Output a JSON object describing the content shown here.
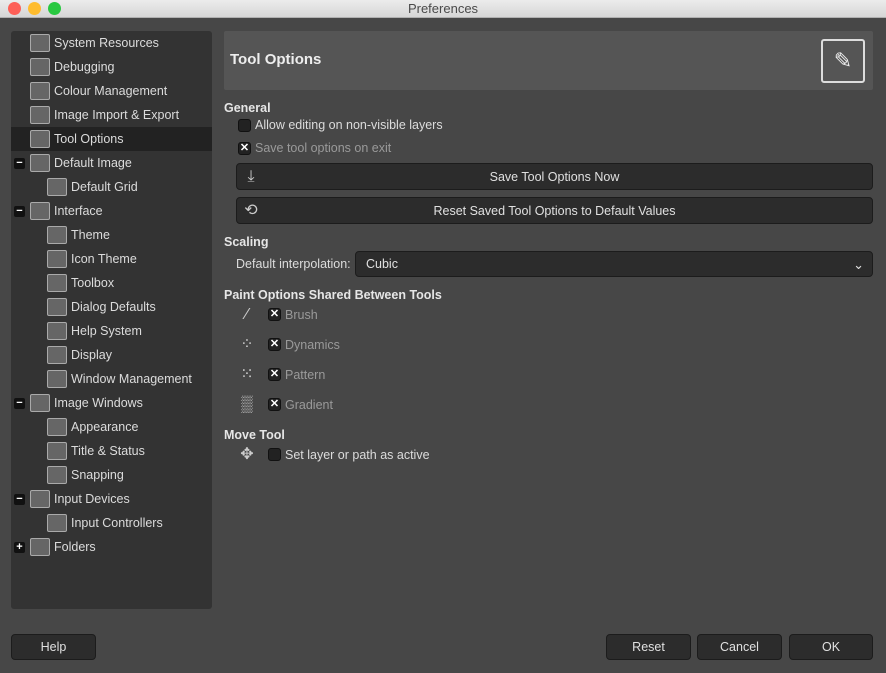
{
  "window": {
    "title": "Preferences"
  },
  "sidebar": {
    "items": [
      {
        "label": "System Resources",
        "icon": "chip-icon"
      },
      {
        "label": "Debugging",
        "icon": "wilber-icon"
      },
      {
        "label": "Colour Management",
        "icon": "color-circles-icon"
      },
      {
        "label": "Image Import & Export",
        "icon": "import-export-icon"
      },
      {
        "label": "Tool Options",
        "icon": "tool-options-icon"
      },
      {
        "label": "Default Image",
        "icon": "default-image-icon"
      },
      {
        "label": "Default Grid",
        "icon": "grid-icon"
      },
      {
        "label": "Interface",
        "icon": "interface-icon"
      },
      {
        "label": "Theme",
        "icon": "theme-icon"
      },
      {
        "label": "Icon Theme",
        "icon": "icon-theme-icon"
      },
      {
        "label": "Toolbox",
        "icon": "toolbox-icon"
      },
      {
        "label": "Dialog Defaults",
        "icon": "dialog-icon"
      },
      {
        "label": "Help System",
        "icon": "help-icon"
      },
      {
        "label": "Display",
        "icon": "display-icon"
      },
      {
        "label": "Window Management",
        "icon": "window-icon"
      },
      {
        "label": "Image Windows",
        "icon": "image-window-icon"
      },
      {
        "label": "Appearance",
        "icon": "appearance-icon"
      },
      {
        "label": "Title & Status",
        "icon": "title-status-icon"
      },
      {
        "label": "Snapping",
        "icon": "snapping-icon"
      },
      {
        "label": "Input Devices",
        "icon": "input-devices-icon"
      },
      {
        "label": "Input Controllers",
        "icon": "controller-icon"
      },
      {
        "label": "Folders",
        "icon": "folder-icon"
      }
    ]
  },
  "main": {
    "title": "Tool Options",
    "general": {
      "heading": "General",
      "allow_editing": "Allow editing on non-visible layers",
      "save_on_exit": "Save tool options on exit",
      "save_now": "Save Tool Options Now",
      "reset_saved": "Reset Saved Tool Options to Default Values"
    },
    "scaling": {
      "heading": "Scaling",
      "interp_label": "Default interpolation:",
      "interp_value": "Cubic"
    },
    "paint": {
      "heading": "Paint Options Shared Between Tools",
      "brush": "Brush",
      "dynamics": "Dynamics",
      "pattern": "Pattern",
      "gradient": "Gradient"
    },
    "move": {
      "heading": "Move Tool",
      "set_active": "Set layer or path as active"
    }
  },
  "footer": {
    "help": "Help",
    "reset": "Reset",
    "cancel": "Cancel",
    "ok": "OK"
  }
}
